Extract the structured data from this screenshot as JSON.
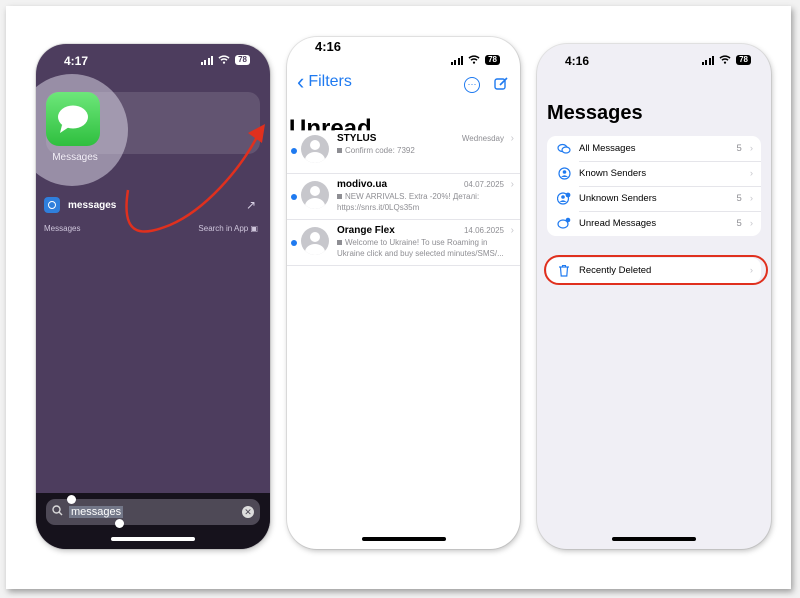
{
  "panel_spotlight": {
    "status_time": "4:17",
    "battery": "78",
    "top_hit_app_label": "Messages",
    "result_row_label": "messages",
    "section_label": "Messages",
    "section_action": "Search in App",
    "search_query": "messages"
  },
  "panel_list": {
    "status_time": "4:16",
    "battery": "78",
    "back_label": "Filters",
    "list_title_partial": "Unread",
    "messages": [
      {
        "sender": "STYLUS",
        "date": "Wednesday",
        "preview": "Confirm code: 7392"
      },
      {
        "sender": "modivo.ua",
        "date": "04.07.2025",
        "preview": "NEW ARRIVALS. Extra -20%! Деталі: https://snrs.it/0LQs35m"
      },
      {
        "sender": "Orange Flex",
        "date": "14.06.2025",
        "preview": "Welcome to Ukraine! To use Roaming in Ukraine click and buy selected minutes/SMS/..."
      }
    ]
  },
  "panel_filters": {
    "status_time": "4:16",
    "battery": "78",
    "title": "Messages",
    "filters": [
      {
        "label": "All Messages",
        "count": "5",
        "icon": "bubbles-icon"
      },
      {
        "label": "Known Senders",
        "count": "",
        "icon": "person-circle-icon"
      },
      {
        "label": "Unknown Senders",
        "count": "5",
        "icon": "person-question-icon"
      },
      {
        "label": "Unread Messages",
        "count": "5",
        "icon": "bubble-dot-icon"
      }
    ],
    "recently_deleted_label": "Recently Deleted"
  },
  "colors": {
    "accent": "#1f7af0",
    "annotation": "#e0301e",
    "spotlight_bg": "#4d3d5e"
  }
}
